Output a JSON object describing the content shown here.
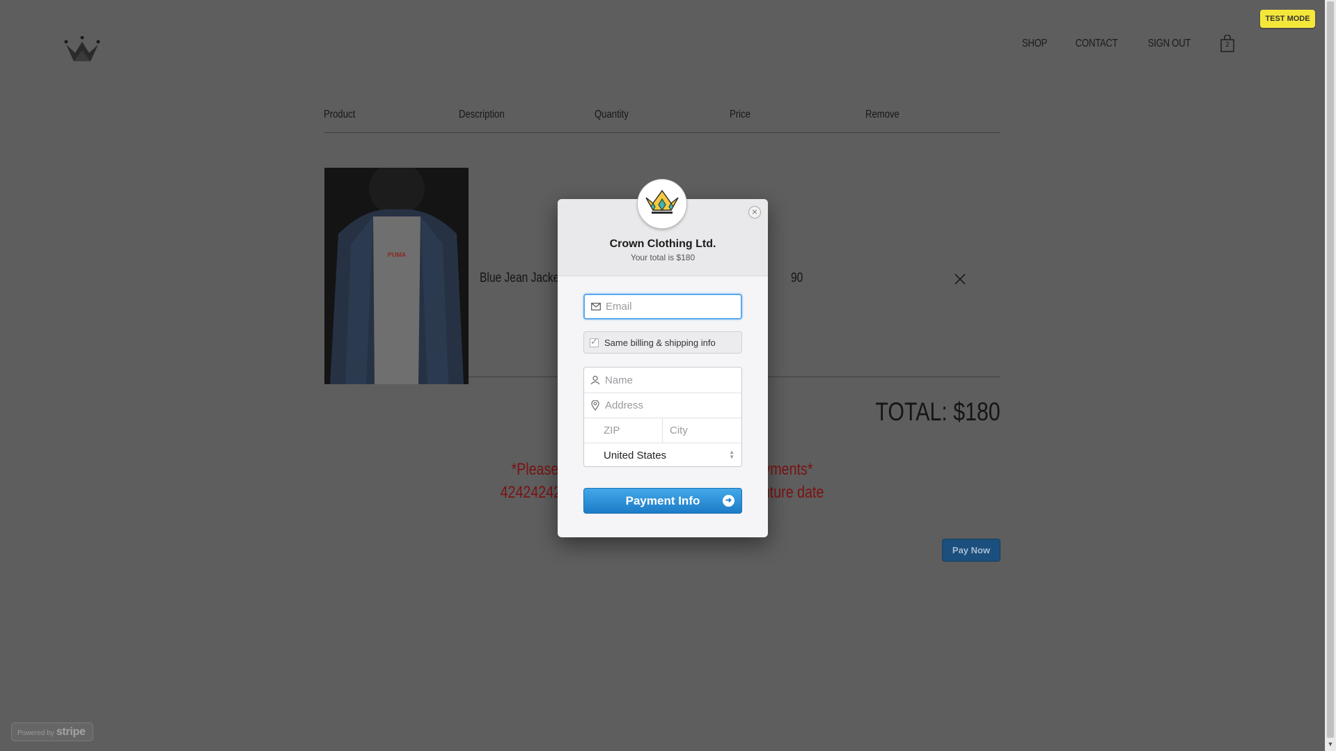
{
  "header": {
    "nav": [
      "SHOP",
      "CONTACT",
      "SIGN OUT"
    ],
    "cart_count": "2",
    "test_mode": "TEST MODE"
  },
  "table": {
    "headers": [
      "Product",
      "Description",
      "Quantity",
      "Price",
      "Remove"
    ],
    "rows": [
      {
        "description": "Blue Jean Jacket",
        "price": "90",
        "image": "PUMA"
      }
    ]
  },
  "total": "TOTAL: $180",
  "warning": {
    "line1": "*Please us",
    "line1_end": "payments*",
    "line2": "4242424242",
    "line2_end": "y future date"
  },
  "pay_now": "Pay Now",
  "powered_by": {
    "prefix": "Powered by",
    "brand": "stripe"
  },
  "modal": {
    "merchant": "Crown Clothing Ltd.",
    "subtotal": "Your total is $180",
    "email_placeholder": "Email",
    "same_billing": "Same billing & shipping info",
    "name_placeholder": "Name",
    "address_placeholder": "Address",
    "zip_placeholder": "ZIP",
    "city_placeholder": "City",
    "country": "United States",
    "payment_button": "Payment Info",
    "close": "×"
  },
  "colors": {
    "overlay": "#5e5e5e",
    "test_badge": "#f4e73a",
    "warning_text": "#7b1212",
    "pay_now_bg": "#1b4f7d",
    "stripe_blue": "#1d7cc8"
  }
}
